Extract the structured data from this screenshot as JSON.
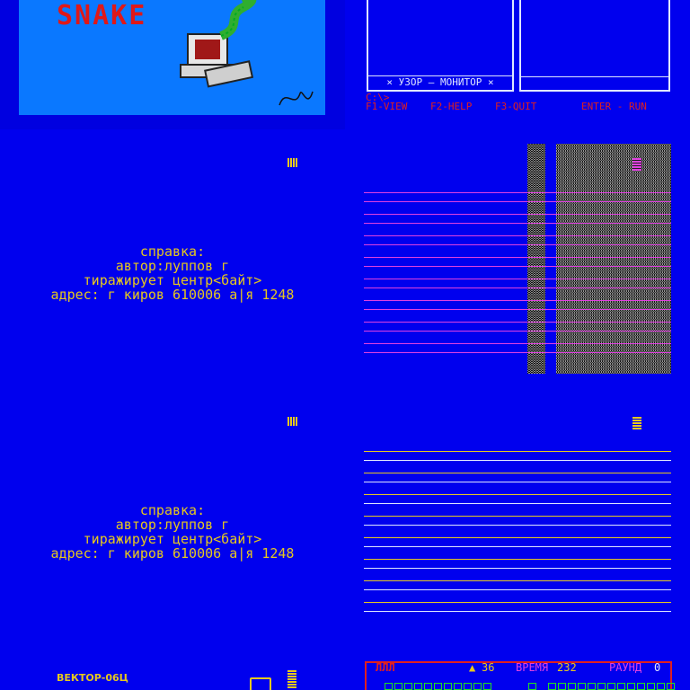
{
  "title_screen": {
    "game_title": "SNAKE"
  },
  "monitor_screen": {
    "left_panel_caption": "× УЗОР — МОНИТОР ×",
    "prompt": "C:\\>",
    "hotkeys": [
      "F1-VIEW",
      "F2-HELP",
      "F3-QUIT",
      "ENTER - RUN"
    ]
  },
  "help_screen": {
    "lines": [
      "справка:",
      "автор:луппов г",
      "тиражирует центр<байт>",
      "адрес: г киров 610006 а|я 1248"
    ]
  },
  "bottom_left": {
    "label": "ВЕКТОР-06Ц"
  },
  "game_hud": {
    "lives_icons": "ЛЛЛ",
    "arrow_count": "36",
    "time_label": "ВРЕМЯ",
    "time_value": "232",
    "round_label": "РАУНД",
    "round_value": "0"
  },
  "colors": {
    "background_blue": "#0000ee",
    "text_yellow": "#e6c81e",
    "text_red": "#e02020",
    "hud_magenta": "#e040e0"
  }
}
